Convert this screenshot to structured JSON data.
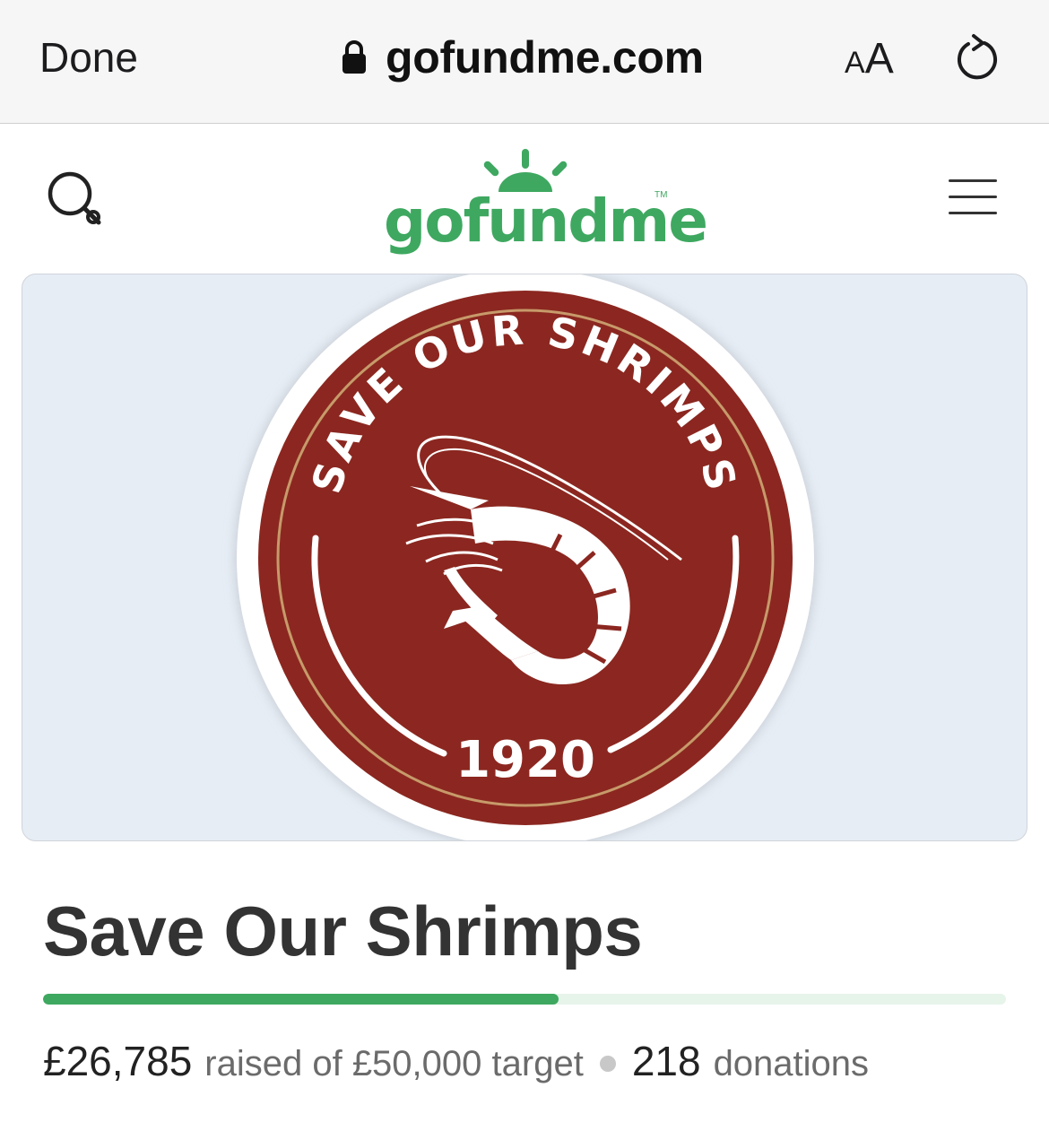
{
  "browser": {
    "done_label": "Done",
    "url": "gofundme.com",
    "aa_small": "A",
    "aa_big": "A",
    "lock_icon": "lock-icon",
    "reload_icon": "reload-icon"
  },
  "header": {
    "logo_text": "gofundme",
    "logo_tm": "TM",
    "search_icon": "search-icon",
    "menu_icon": "hamburger-menu-icon",
    "brand_color": "#3ea860"
  },
  "hero": {
    "badge_arc_text": "SAVE OUR SHRIMPS",
    "badge_year": "1920",
    "badge_color": "#8b2720"
  },
  "campaign": {
    "title": "Save Our Shrimps",
    "raised_amount": "£26,785",
    "raised_label": "raised of £50,000 target",
    "donation_count": "218",
    "donation_label": "donations",
    "progress_fraction": 0.5357
  }
}
